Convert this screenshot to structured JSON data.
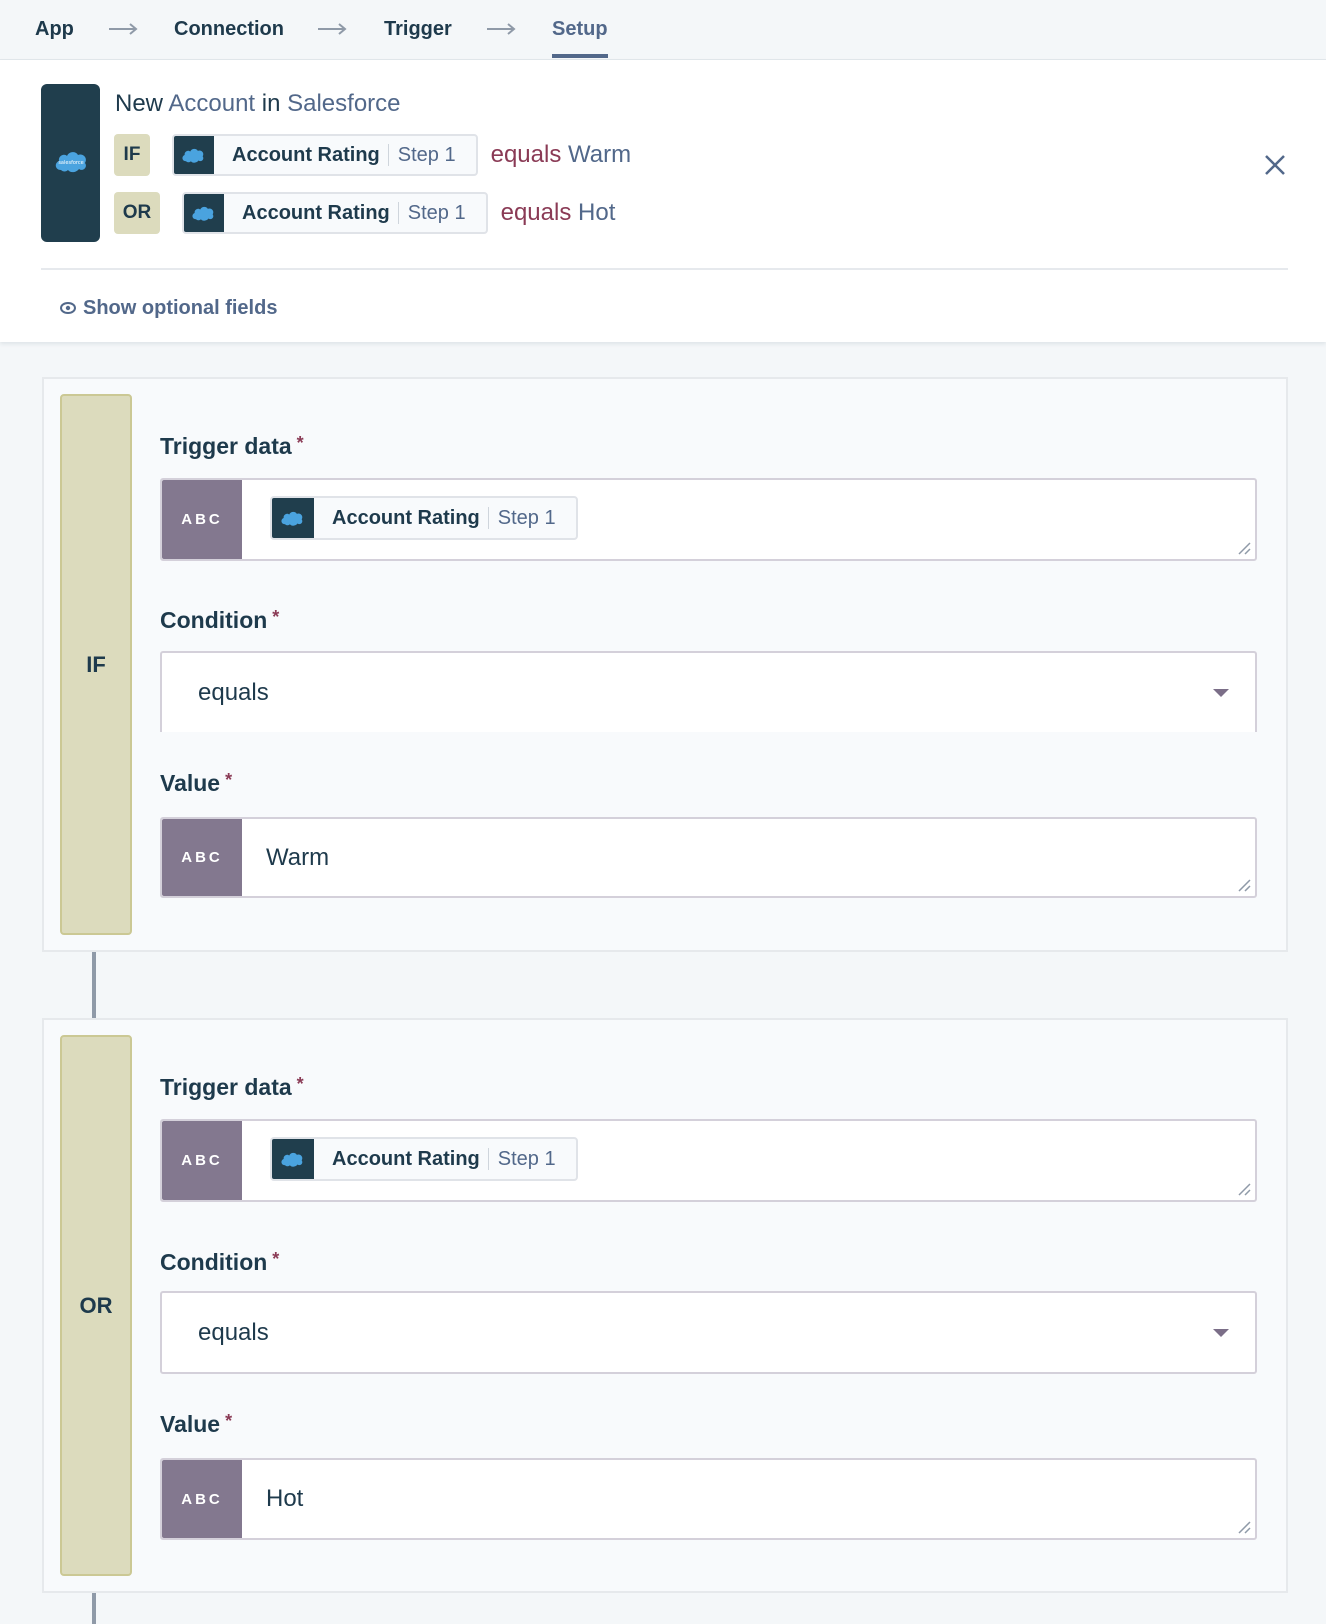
{
  "stepnav": {
    "steps": [
      {
        "label": "App",
        "active": false
      },
      {
        "label": "Connection",
        "active": false
      },
      {
        "label": "Trigger",
        "active": false
      },
      {
        "label": "Setup",
        "active": true
      }
    ]
  },
  "header": {
    "app_icon": "salesforce-logo-icon",
    "title_prefix": "New",
    "title_object": "Account",
    "title_in": "in",
    "title_app": "Salesforce",
    "conditions": [
      {
        "keyword": "IF",
        "field": "Account Rating",
        "step": "Step 1",
        "operator": "equals",
        "value": "Warm"
      },
      {
        "keyword": "OR",
        "field": "Account Rating",
        "step": "Step 1",
        "operator": "equals",
        "value": "Hot"
      }
    ],
    "close_icon": "close-icon",
    "optional_fields_label": "Show optional fields",
    "optional_fields_icon": "eye-icon"
  },
  "blocks": [
    {
      "keyword": "IF",
      "trigger_label": "Trigger data",
      "trigger_type": "ABC",
      "trigger_field": "Account Rating",
      "trigger_step": "Step 1",
      "condition_label": "Condition",
      "condition_value": "equals",
      "value_label": "Value",
      "value_type": "ABC",
      "value": "Warm"
    },
    {
      "keyword": "OR",
      "trigger_label": "Trigger data",
      "trigger_type": "ABC",
      "trigger_field": "Account Rating",
      "trigger_step": "Step 1",
      "condition_label": "Condition",
      "condition_value": "equals",
      "value_label": "Value",
      "value_type": "ABC",
      "value": "Hot"
    }
  ],
  "required_marker": "*",
  "colors": {
    "primary_text": "#1e3a4c",
    "accent": "#52688a",
    "operator": "#8a3a55",
    "keyword_badge": "#dcdbbd",
    "type_badge": "#83788f",
    "app_tile": "#203e4d",
    "salesforce_blue": "#4aa3df"
  }
}
